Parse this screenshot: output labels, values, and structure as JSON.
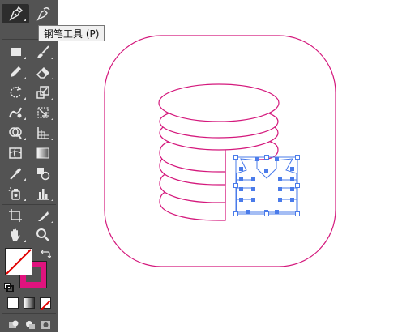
{
  "toolbar": {
    "tools": [
      {
        "id": "pen",
        "icon": "pen-icon"
      },
      {
        "id": "curvature",
        "icon": "curvature-pen-icon"
      },
      {
        "id": "rectangle",
        "icon": "rectangle-icon"
      },
      {
        "id": "paintbrush",
        "icon": "paintbrush-icon"
      },
      {
        "id": "pencil",
        "icon": "pencil-icon"
      },
      {
        "id": "eraser",
        "icon": "eraser-icon"
      },
      {
        "id": "rotate",
        "icon": "rotate-icon"
      },
      {
        "id": "scale",
        "icon": "scale-icon"
      },
      {
        "id": "warp",
        "icon": "warp-icon"
      },
      {
        "id": "free-transform",
        "icon": "free-transform-icon"
      },
      {
        "id": "shape-builder",
        "icon": "shape-builder-icon"
      },
      {
        "id": "perspective-grid",
        "icon": "perspective-grid-icon"
      },
      {
        "id": "mesh",
        "icon": "mesh-icon"
      },
      {
        "id": "gradient",
        "icon": "gradient-icon"
      },
      {
        "id": "eyedropper",
        "icon": "eyedropper-icon"
      },
      {
        "id": "blend",
        "icon": "blend-icon"
      },
      {
        "id": "symbol-sprayer",
        "icon": "symbol-sprayer-icon"
      },
      {
        "id": "column-graph",
        "icon": "column-graph-icon"
      },
      {
        "id": "artboard",
        "icon": "artboard-icon"
      },
      {
        "id": "slice",
        "icon": "slice-icon"
      },
      {
        "id": "hand",
        "icon": "hand-icon"
      },
      {
        "id": "zoom",
        "icon": "zoom-icon"
      }
    ],
    "active_tool": "pen",
    "tooltip": "钢笔工具 (P)"
  },
  "colors": {
    "toolbar_bg": "#535353",
    "stroke_color": "#e0137e",
    "artwork_stroke": "#d4187c",
    "selection": "#4a7bea",
    "fill": "none"
  }
}
